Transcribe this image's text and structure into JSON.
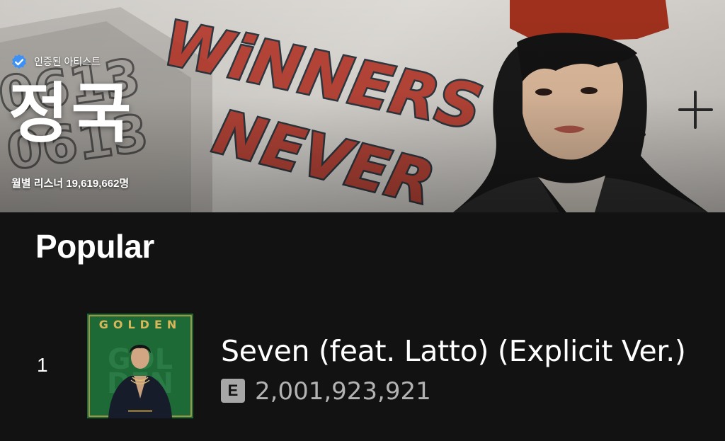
{
  "artist": {
    "verified_label": "인증된 아티스트",
    "name": "정국",
    "monthly_listeners": "월별 리스너 19,619,662명",
    "banner_graffiti": [
      "WiNNERS",
      "NEVER",
      "0613",
      "0613"
    ]
  },
  "popular": {
    "title": "Popular",
    "tracks": [
      {
        "index": "1",
        "title": "Seven (feat. Latto) (Explicit Ver.)",
        "explicit_badge": "E",
        "plays": "2,001,923,921",
        "cover_text": "GOLDEN"
      }
    ]
  },
  "colors": {
    "background": "#121212",
    "verified_blue": "#3d91f4",
    "cover_green": "#1e6a37",
    "cover_gold": "#d8b65a",
    "explicit_badge": "#a7a7a7",
    "secondary_text": "#b3b3b3"
  },
  "icons": {
    "verified": "verified-badge-icon",
    "explicit": "explicit-badge-icon"
  }
}
